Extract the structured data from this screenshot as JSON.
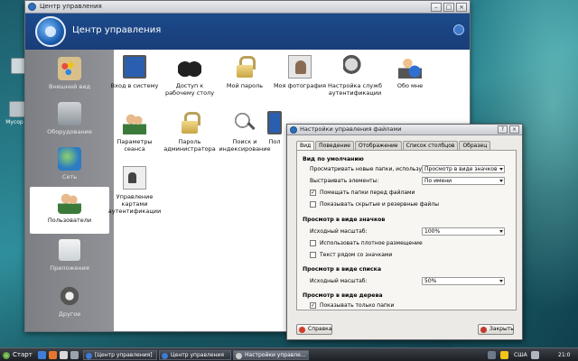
{
  "main_window": {
    "title": "Центр управления",
    "header_title": "Центр управления",
    "sidebar": [
      {
        "label": "Внешний вид"
      },
      {
        "label": "Оборудование"
      },
      {
        "label": "Сеть"
      },
      {
        "label": "Пользователи",
        "active": true
      },
      {
        "label": "Приложения"
      },
      {
        "label": "Другое"
      }
    ],
    "items": [
      {
        "label": "Вход в систему",
        "icon": "monitor-icon"
      },
      {
        "label": "Доступ к рабочему столу",
        "icon": "binoculars-icon"
      },
      {
        "label": "Мой пароль",
        "icon": "padlock-icon"
      },
      {
        "label": "Моя фотография",
        "icon": "photo-icon"
      },
      {
        "label": "Настройка служб аутентификации",
        "icon": "key-icon"
      },
      {
        "label": "Обо мне",
        "icon": "user-card-icon"
      },
      {
        "label": "Параметры сеанса",
        "icon": "users-icon"
      },
      {
        "label": "Пароль администратора",
        "icon": "padlock-icon"
      },
      {
        "label": "Поиск и индексирование",
        "icon": "magnifier-icon"
      },
      {
        "label": "Пол",
        "icon": "partial-icon"
      },
      {
        "label": "Управление картами аутентификации",
        "icon": "id-card-icon"
      }
    ]
  },
  "dialog": {
    "title": "Настройки управления файлами",
    "tabs": [
      "Вид",
      "Поведение",
      "Отображение",
      "Список столбцов",
      "Образец"
    ],
    "active_tab": "Вид",
    "section_default": "Вид по умолчанию",
    "view_new_label": "Просматривать новые папки, используя:",
    "view_new_value": "Просмотр в виде значков",
    "arrange_label": "Выстраивать элементы:",
    "arrange_value": "По имени",
    "folders_first_label": "Помещать папки перед файлами",
    "folders_first_checked": true,
    "show_hidden_label": "Показывать скрытые и резервные файлы",
    "show_hidden_checked": false,
    "section_icons": "Просмотр в виде значков",
    "icons_zoom_label": "Исходный масштаб:",
    "icons_zoom_value": "100%",
    "compact_label": "Использовать плотное размещение",
    "compact_checked": false,
    "text_beside_label": "Текст рядом со значками",
    "text_beside_checked": false,
    "section_list": "Просмотр в виде списка",
    "list_zoom_label": "Исходный масштаб:",
    "list_zoom_value": "50%",
    "section_tree": "Просмотр в виде дерева",
    "only_folders_label": "Показывать только папки",
    "only_folders_checked": true,
    "help_button": "Справка",
    "close_button": "Закрыть",
    "check_mark": "✓"
  },
  "desktop": {
    "icon_label": "Мусор"
  },
  "taskbar": {
    "start_label": "Старт",
    "tasks": [
      "[Центр управления]",
      "Центр управления",
      "Настройки управле..."
    ],
    "lang": "США",
    "clock": "21:0"
  },
  "colors": {
    "header_bg": "#1b4a8c",
    "sidebar_bg": "#858789",
    "dialog_bg": "#eceae6",
    "taskbar_bg": "#1c1f24"
  }
}
